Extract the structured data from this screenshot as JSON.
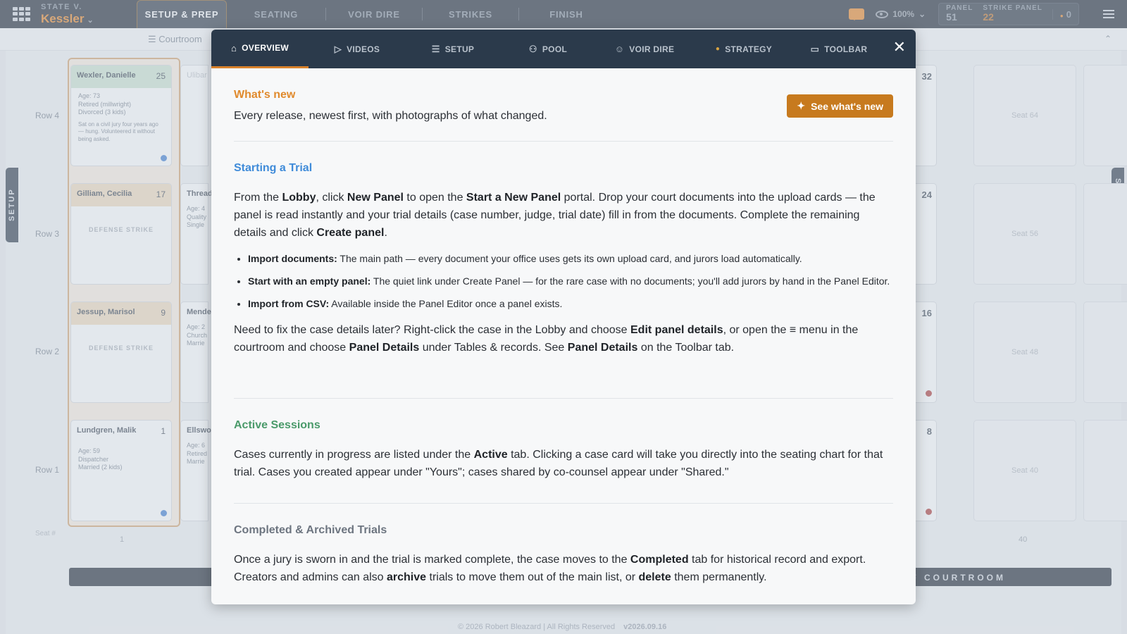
{
  "topbar": {
    "case_kicker": "STATE V.",
    "case_name": "Kessler",
    "tabs": [
      {
        "label": "SETUP & PREP",
        "active": true
      },
      {
        "label": "SEATING"
      },
      {
        "label": "VOIR DIRE"
      },
      {
        "label": "STRIKES"
      },
      {
        "label": "FINISH"
      }
    ],
    "zoom": "100%",
    "panel_label": "PANEL",
    "panel_value": "51",
    "strike_panel_label": "STRIKE PANEL",
    "strike_panel_value": "22",
    "count": "0",
    "accent": "#d9822b"
  },
  "subbar": {
    "label": "Courtroom"
  },
  "side_tabs": {
    "left": "SETUP",
    "right": "STRATEGY"
  },
  "rows": [
    "Row 4",
    "Row 3",
    "Row 2",
    "Row 1"
  ],
  "jurors": [
    {
      "name": "Wexler, Danielle",
      "num": "25",
      "lines": [
        "Age: 73",
        "Retired (millwright)",
        "Divorced (3 kids)"
      ],
      "note": "Sat on a civil jury four years ago — hung. Volunteered it without being asked."
    },
    {
      "name": "Gilliam, Cecilia",
      "num": "17",
      "status": "DEFENSE STRIKE"
    },
    {
      "name": "Jessup, Marisol",
      "num": "9",
      "status": "DEFENSE STRIKE"
    },
    {
      "name": "Lundgren, Malik",
      "num": "1",
      "lines": [
        "Age: 59",
        "Dispatcher",
        "Married (2 kids)"
      ]
    }
  ],
  "partial_cards": [
    {
      "name": "Ulibar",
      "lines": []
    },
    {
      "name": "Thread",
      "lines": [
        "Age: 4",
        "Quality",
        "Single"
      ]
    },
    {
      "name": "Mende",
      "lines": [
        "Age: 2",
        "Church",
        "Marrie"
      ]
    },
    {
      "name": "Ellswo",
      "lines": [
        "Age: 6",
        "Retired",
        "Marrie"
      ]
    }
  ],
  "right_nums": [
    "32",
    "24",
    "16",
    "8"
  ],
  "empty_seats": [
    "Seat 64",
    "Seat 56",
    "Seat 48",
    "Seat 40"
  ],
  "seat_hash": "Seat #",
  "seat_numbers": [
    "1",
    "40"
  ],
  "front_label": "T OF COURTROOM",
  "footer": {
    "copyright": "© 2026 Robert Bleazard | All Rights Reserved",
    "version": "v2026.09.16"
  },
  "modal": {
    "tabs": [
      {
        "label": "OVERVIEW",
        "icon": "home-icon",
        "glyph": "⌂"
      },
      {
        "label": "VIDEOS",
        "icon": "play-icon",
        "glyph": "▷"
      },
      {
        "label": "SETUP",
        "icon": "sliders-icon",
        "glyph": "☰"
      },
      {
        "label": "POOL",
        "icon": "people-icon",
        "glyph": "⚇"
      },
      {
        "label": "VOIR DIRE",
        "icon": "speaker-icon",
        "glyph": "☺"
      },
      {
        "label": "STRATEGY",
        "icon": "lightbulb-icon",
        "glyph": "●"
      },
      {
        "label": "TOOLBAR",
        "icon": "toolbar-icon",
        "glyph": "▭"
      }
    ],
    "close_glyph": "✕",
    "whats_new": {
      "heading": "What's new",
      "text": "Every release, newest first, with photographs of what changed.",
      "button": "See what's new",
      "button_glyph": "✦"
    },
    "starting": {
      "heading": "Starting a Trial",
      "p1_a": "From the ",
      "p1_b": "Lobby",
      "p1_c": ", click ",
      "p1_d": "New Panel",
      "p1_e": " to open the ",
      "p1_f": "Start a New Panel",
      "p1_g": " portal. Drop your court documents into the upload cards — the panel is read instantly and your trial details (case number, judge, trial date) fill in from the documents. Complete the remaining details and click ",
      "p1_h": "Create panel",
      "p1_i": ".",
      "bullets": [
        {
          "bold": "Import documents:",
          "text": " The main path — every document your office uses gets its own upload card, and jurors load automatically."
        },
        {
          "bold": "Start with an empty panel:",
          "text": " The quiet link under Create Panel — for the rare case with no documents; you'll add jurors by hand in the Panel Editor."
        },
        {
          "bold": "Import from CSV:",
          "text": " Available inside the Panel Editor once a panel exists."
        }
      ],
      "p2_a": "Need to fix the case details later? Right-click the case in the Lobby and choose ",
      "p2_b": "Edit panel details",
      "p2_c": ", or open the ",
      "p2_glyph": "≡",
      "p2_d": " menu in the courtroom and choose ",
      "p2_e": "Panel Details",
      "p2_f": " under Tables & records. See ",
      "p2_g": "Panel Details",
      "p2_h": " on the Toolbar tab."
    },
    "active": {
      "heading": "Active Sessions",
      "p_a": "Cases currently in progress are listed under the ",
      "p_b": "Active",
      "p_c": " tab. Clicking a case card will take you directly into the seating chart for that trial. Cases you created appear under \"Yours\"; cases shared by co-counsel appear under \"Shared.\""
    },
    "completed": {
      "heading": "Completed & Archived Trials",
      "p_a": "Once a jury is sworn in and the trial is marked complete, the case moves to the ",
      "p_b": "Completed",
      "p_c": " tab for historical record and export. Creators and admins can also ",
      "p_d": "archive",
      "p_e": " trials to move them out of the main list, or ",
      "p_f": "delete",
      "p_g": " them permanently."
    }
  }
}
